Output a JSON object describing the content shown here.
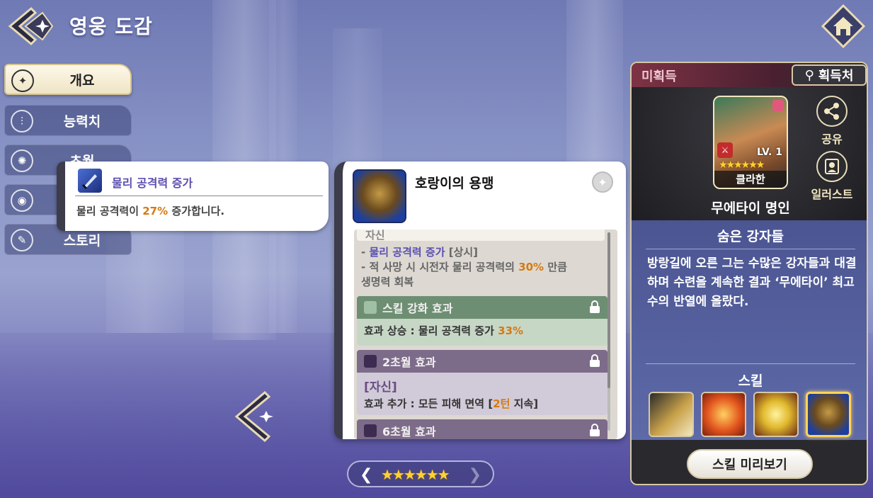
{
  "header": {
    "title": "영웅 도감"
  },
  "tabs": [
    {
      "label": "개요",
      "icon": "sparkle-icon",
      "active": true
    },
    {
      "label": "능력치",
      "icon": "stats-icon",
      "active": false
    },
    {
      "label": "초월",
      "icon": "transcend-icon",
      "active": false
    },
    {
      "label": "",
      "icon": "profile-icon",
      "active": false
    },
    {
      "label": "스토리",
      "icon": "quill-icon",
      "active": false
    }
  ],
  "tooltip": {
    "title": "물리 공격력 증가",
    "desc_prefix": "물리 공격력이 ",
    "desc_value": "27%",
    "desc_suffix": " 증가합니다."
  },
  "skill_card": {
    "name": "호랑이의 용맹",
    "section_partial": "자신",
    "line1_prefix": "- ",
    "line1_buff": "물리 공격력 증가",
    "line1_tag": " [상시]",
    "line2_prefix": "- 적 사망 시 시전자 물리 공격력의 ",
    "line2_value": "30%",
    "line2_suffix": " 만큼",
    "line3": "생명력 회복",
    "enhance": {
      "title": "스킬 강화 효과",
      "body_prefix": "효과 상승 : 물리 공격력 증가 ",
      "body_value": "33%"
    },
    "transcend2": {
      "title": "2초월 효과",
      "target": "[자신]",
      "body_prefix": "효과 추가 : 모든 피해 면역 [",
      "body_value": "2턴",
      "body_suffix": " 지속]"
    },
    "transcend6": {
      "title": "6초월 효과"
    }
  },
  "pager": {
    "stars": "★★★★★★"
  },
  "right_panel": {
    "status": "미획득",
    "acquire_label": "획득처",
    "portrait": {
      "name": "클라한",
      "level": "LV. 1",
      "stars": "★★★★★★"
    },
    "hero_title": "무에타이 명인",
    "share_label": "공유",
    "illust_label": "일러스트",
    "subtitle": "숨은 강자들",
    "description": "방랑길에 오른 그는 수많은 강자들과 대결하며 수련을 계속한 결과 ‘무에타이’ 최고수의 반열에 올랐다.",
    "skills_title": "스킬",
    "preview_label": "스킬 미리보기"
  },
  "colors": {
    "accent_gold": "#d6c9a5",
    "highlight_orange": "#d57a12",
    "buff_purple": "#5a4fb0"
  }
}
